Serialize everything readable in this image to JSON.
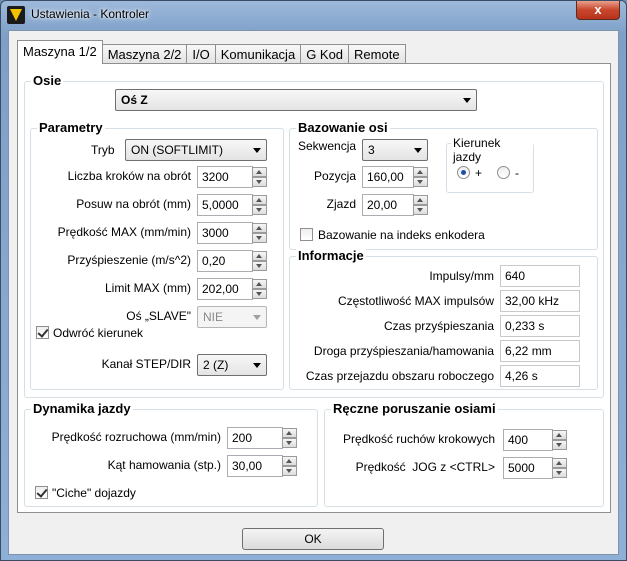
{
  "window": {
    "title": "Ustawienia - Kontroler",
    "close": "x"
  },
  "tabs": [
    {
      "label": "Maszyna 1/2",
      "active": true
    },
    {
      "label": "Maszyna 2/2"
    },
    {
      "label": "I/O"
    },
    {
      "label": "Komunikacja"
    },
    {
      "label": "G Kod"
    },
    {
      "label": "Remote"
    }
  ],
  "osie": {
    "title": "Osie",
    "selected_axis": "Oś Z"
  },
  "parametry": {
    "title": "Parametry",
    "tryb": {
      "label": "Tryb",
      "value": "ON (SOFTLIMIT)"
    },
    "fields": [
      {
        "label": "Liczba kroków na obrót",
        "value": "3200"
      },
      {
        "label": "Posuw na obrót (mm)",
        "value": "5,0000"
      },
      {
        "label": "Prędkość MAX (mm/min)",
        "value": "3000"
      },
      {
        "label": "Przyśpieszenie (m/s^2)",
        "value": "0,20"
      },
      {
        "label": "Limit MAX (mm)",
        "value": "202,00"
      }
    ],
    "slave": {
      "label": "Oś „SLAVE\"",
      "value": "NIE"
    },
    "odwroc": {
      "label": "Odwróć kierunek",
      "checked": true
    },
    "kanal": {
      "label": "Kanał STEP/DIR",
      "value": "2 (Z)"
    }
  },
  "bazowanie": {
    "title": "Bazowanie osi",
    "sekwencja": {
      "label": "Sekwencja",
      "value": "3"
    },
    "pozycja": {
      "label": "Pozycja",
      "value": "160,00"
    },
    "zjazd": {
      "label": "Zjazd",
      "value": "20,00"
    },
    "kierunek": {
      "title": "Kierunek jazdy",
      "plus": "+",
      "minus": "-",
      "selected": "+"
    },
    "enkoder": {
      "label": "Bazowanie na indeks enkodera",
      "checked": false
    }
  },
  "informacje": {
    "title": "Informacje",
    "rows": [
      {
        "label": "Impulsy/mm",
        "value": "640"
      },
      {
        "label": "Częstotliwość MAX impulsów",
        "value": "32,00 kHz"
      },
      {
        "label": "Czas przyśpieszania",
        "value": "0,233 s"
      },
      {
        "label": "Droga przyśpieszania/hamowania",
        "value": "6,22 mm"
      },
      {
        "label": "Czas przejazdu obszaru roboczego",
        "value": "4,26 s"
      }
    ]
  },
  "dynamika": {
    "title": "Dynamika jazdy",
    "rozruch": {
      "label": "Prędkość rozruchowa (mm/min)",
      "value": "200"
    },
    "kat": {
      "label": "Kąt hamowania (stp.)",
      "value": "30,00"
    },
    "ciche": {
      "label": "\"Ciche\" dojazdy",
      "checked": true
    }
  },
  "reczne": {
    "title": "Ręczne poruszanie osiami",
    "krokowe": {
      "label": "Prędkość ruchów krokowych",
      "value": "400"
    },
    "jog": {
      "label": "Prędkość  JOG z <CTRL>",
      "value": "5000"
    }
  },
  "ok": "OK"
}
